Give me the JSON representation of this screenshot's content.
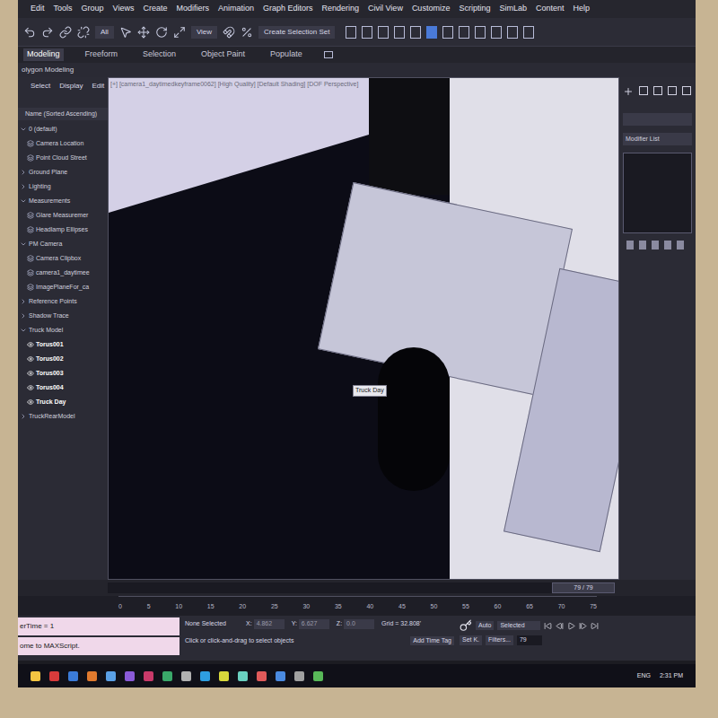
{
  "menu": [
    "Edit",
    "Tools",
    "Group",
    "Views",
    "Create",
    "Modifiers",
    "Animation",
    "Graph Editors",
    "Rendering",
    "Civil View",
    "Customize",
    "Scripting",
    "SimLab",
    "Content",
    "Help"
  ],
  "toolbar": {
    "filter": "All",
    "reference": "View",
    "selection_set": "Create Selection Set"
  },
  "ribbon_tabs": [
    {
      "label": "Modeling",
      "selected": true
    },
    {
      "label": "Freeform",
      "selected": false
    },
    {
      "label": "Selection",
      "selected": false
    },
    {
      "label": "Object Paint",
      "selected": false
    },
    {
      "label": "Populate",
      "selected": false
    }
  ],
  "ribbon_panel": "olygon Modeling",
  "explorer": {
    "tabs": [
      "Select",
      "Display",
      "Edit"
    ],
    "header": "Name (Sorted Ascending)",
    "items": [
      {
        "label": "0 (default)",
        "depth": 0,
        "kind": "group",
        "expanded": true
      },
      {
        "label": "Camera Location",
        "depth": 1,
        "kind": "layer",
        "expanded": false
      },
      {
        "label": "Point Cloud Street",
        "depth": 1,
        "kind": "layer",
        "expanded": false
      },
      {
        "label": "Ground Plane",
        "depth": 0,
        "kind": "group",
        "expanded": false
      },
      {
        "label": "Lighting",
        "depth": 0,
        "kind": "group",
        "expanded": false
      },
      {
        "label": "Measurements",
        "depth": 0,
        "kind": "group",
        "expanded": true
      },
      {
        "label": "Glare Measuremer",
        "depth": 1,
        "kind": "layer",
        "expanded": false
      },
      {
        "label": "Headlamp Ellipses",
        "depth": 1,
        "kind": "layer",
        "expanded": false
      },
      {
        "label": "PM Camera",
        "depth": 0,
        "kind": "group",
        "expanded": true
      },
      {
        "label": "Camera Clipbox",
        "depth": 1,
        "kind": "layer",
        "expanded": false
      },
      {
        "label": "camera1_daytimee",
        "depth": 1,
        "kind": "layer",
        "expanded": false
      },
      {
        "label": "ImagePlaneFor_ca",
        "depth": 1,
        "kind": "layer",
        "expanded": false
      },
      {
        "label": "Reference Points",
        "depth": 0,
        "kind": "group",
        "expanded": false
      },
      {
        "label": "Shadow Trace",
        "depth": 0,
        "kind": "group",
        "expanded": false
      },
      {
        "label": "Truck Model",
        "depth": 0,
        "kind": "group",
        "expanded": true
      },
      {
        "label": "Torus001",
        "depth": 1,
        "kind": "object",
        "expanded": false
      },
      {
        "label": "Torus002",
        "depth": 1,
        "kind": "object",
        "expanded": false
      },
      {
        "label": "Torus003",
        "depth": 1,
        "kind": "object",
        "expanded": false
      },
      {
        "label": "Torus004",
        "depth": 1,
        "kind": "object",
        "expanded": false
      },
      {
        "label": "Truck Day",
        "depth": 1,
        "kind": "object",
        "expanded": false
      },
      {
        "label": "TruckRearModel",
        "depth": 0,
        "kind": "group",
        "expanded": false
      }
    ]
  },
  "viewport": {
    "label": "[+] [camera1_daytimedkeyframe0062] [High Quality] [Default Shading] [DOF Perspective]",
    "tooltip": "Truck Day"
  },
  "command_panel": {
    "modifier_list": "Modifier List"
  },
  "time_slider": {
    "reading": "79 / 79",
    "level": 1
  },
  "timeline": {
    "ticks": [
      "0",
      "5",
      "10",
      "15",
      "20",
      "25",
      "30",
      "35",
      "40",
      "45",
      "50",
      "55",
      "60",
      "65",
      "70",
      "75"
    ]
  },
  "status": {
    "script_lines": [
      "erTime = 1",
      "ome to MAXScript."
    ],
    "selection": "None Selected",
    "prompt": "Click or click-and-drag to select objects",
    "x_label": "X:",
    "x": "4.862",
    "y_label": "Y:",
    "y": "6.627",
    "z_label": "Z:",
    "z": "0.0",
    "grid": "Grid = 32.808'",
    "add_time_tag": "Add Time Tag",
    "auto": "Auto",
    "key_filter": "Selected",
    "set_key": "Set K.",
    "filters": "Filters...",
    "frame": "79"
  },
  "taskbar": {
    "language": "ENG",
    "time": "2:31 PM"
  }
}
